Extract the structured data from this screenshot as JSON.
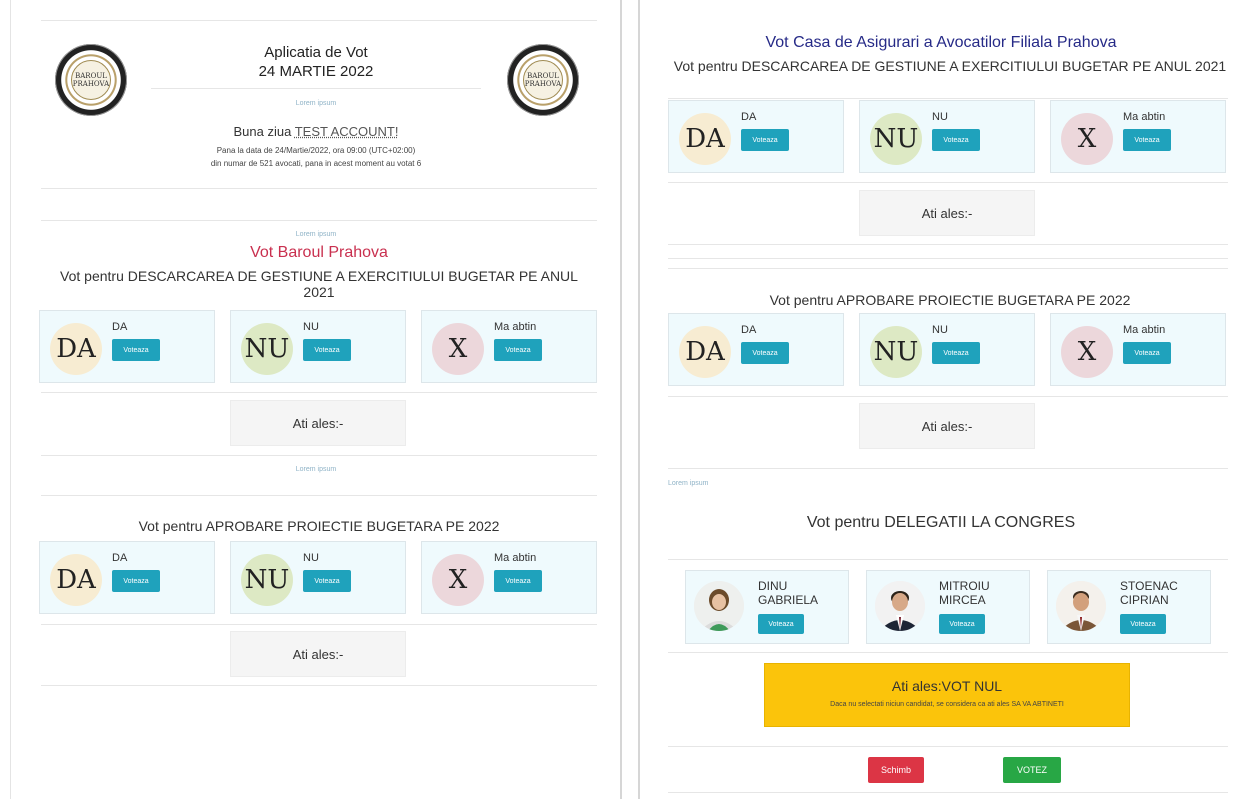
{
  "header": {
    "title": "Aplicatia de Vot",
    "date": "24 MARTIE 2022",
    "seal_text": "BAROUL PRAHOVA",
    "tiny_label": "Lorem ipsum",
    "greeting_prefix": "Buna ziua ",
    "user_name": "TEST ACCOUNT!",
    "info_line_1": "Pana la data de 24/Martie/2022, ora 09:00 (UTC+02:00)",
    "info_line_2": "din numar de 521 avocati, pana in acest moment au votat 6"
  },
  "left": {
    "separator_label": "Lorem ipsum",
    "section_title": "Vot Baroul Prahova",
    "questions": [
      {
        "text": "Vot pentru DESCARCAREA DE GESTIUNE A EXERCITIULUI BUGETAR PE ANUL 2021",
        "options": [
          {
            "icon": "DA",
            "label": "DA",
            "button": "Voteaza"
          },
          {
            "icon": "NU",
            "label": "NU",
            "button": "Voteaza"
          },
          {
            "icon": "X",
            "label": "Ma abtin",
            "button": "Voteaza"
          }
        ],
        "chosen": "Ati ales:-"
      },
      {
        "text": "Vot pentru APROBARE PROIECTIE BUGETARA PE 2022",
        "options": [
          {
            "icon": "DA",
            "label": "DA",
            "button": "Voteaza"
          },
          {
            "icon": "NU",
            "label": "NU",
            "button": "Voteaza"
          },
          {
            "icon": "X",
            "label": "Ma abtin",
            "button": "Voteaza"
          }
        ],
        "chosen": "Ati ales:-"
      }
    ]
  },
  "right": {
    "section_title": "Vot Casa de Asigurari a Avocatilor Filiala Prahova",
    "separator_label": "Lorem ipsum",
    "questions": [
      {
        "text": "Vot pentru DESCARCAREA DE GESTIUNE A EXERCITIULUI BUGETAR PE ANUL 2021",
        "options": [
          {
            "icon": "DA",
            "label": "DA",
            "button": "Voteaza"
          },
          {
            "icon": "NU",
            "label": "NU",
            "button": "Voteaza"
          },
          {
            "icon": "X",
            "label": "Ma abtin",
            "button": "Voteaza"
          }
        ],
        "chosen": "Ati ales:-"
      },
      {
        "text": "Vot pentru APROBARE PROIECTIE BUGETARA PE 2022",
        "options": [
          {
            "icon": "DA",
            "label": "DA",
            "button": "Voteaza"
          },
          {
            "icon": "NU",
            "label": "NU",
            "button": "Voteaza"
          },
          {
            "icon": "X",
            "label": "Ma abtin",
            "button": "Voteaza"
          }
        ],
        "chosen": "Ati ales:-"
      }
    ],
    "delegates": {
      "title": "Vot pentru DELEGATII LA CONGRES",
      "candidates": [
        {
          "name_line1": "DINU",
          "name_line2": "GABRIELA",
          "button": "Voteaza"
        },
        {
          "name_line1": "MITROIU",
          "name_line2": "MIRCEA",
          "button": "Voteaza"
        },
        {
          "name_line1": "STOENAC",
          "name_line2": "CIPRIAN",
          "button": "Voteaza"
        }
      ],
      "warning_title": "Ati ales:VOT NUL",
      "warning_text": "Daca nu selectati niciun candidat, se considera ca ati ales SA VA ABTINETI",
      "change_button": "Schimb",
      "vote_button": "VOTEZ"
    }
  }
}
